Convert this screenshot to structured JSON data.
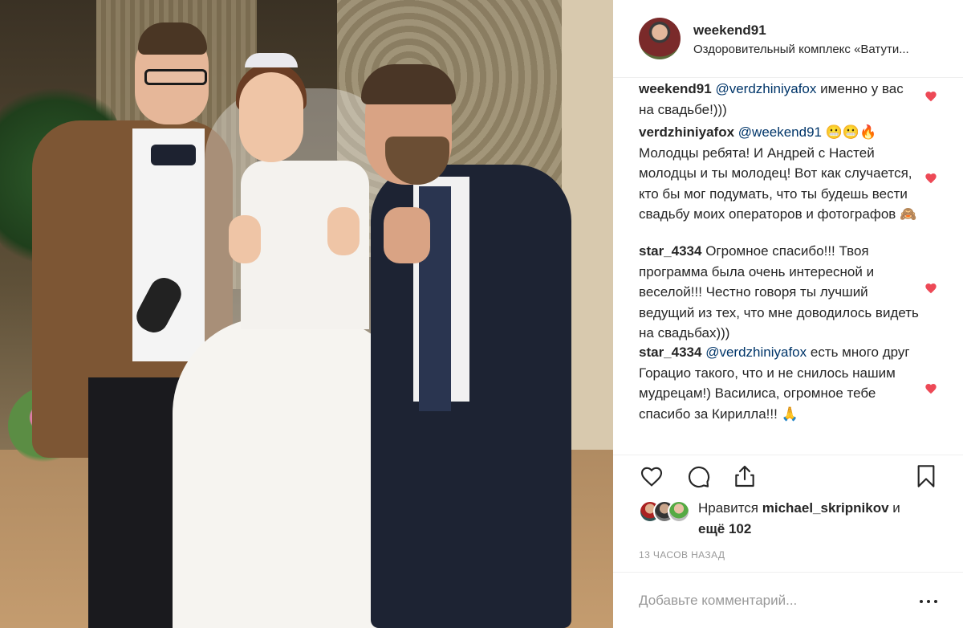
{
  "post": {
    "username": "weekend91",
    "location": "Оздоровительный комплекс «Ватути..."
  },
  "comments": [
    {
      "username": "weekend91",
      "mention": "@verdzhiniyafox",
      "text": " именно у вас на свадьбе!)))"
    },
    {
      "username": "verdzhiniyafox",
      "mention": "@weekend91",
      "text": " 😬😬🔥 Молодцы ребята! И Андрей с Настей молодцы и ты молодец! Вот как случается, кто бы мог подумать, что ты будешь вести свадьбу моих операторов и фотографов 🙈"
    },
    {
      "username": "star_4334",
      "mention": "",
      "text": "Огромное спасибо!!! Твоя программа была очень интересной и веселой!!! Честно говоря ты лучший ведущий из тех, что мне доводилось видеть на свадьбах)))"
    },
    {
      "username": "star_4334",
      "mention": "@verdzhiniyafox",
      "text": " есть много друг Горацио такого, что и не снилось нашим мудрецам!) Василиса, огромное тебе спасибо за Кирилла!!! 🙏"
    }
  ],
  "likes": {
    "prefix": "Нравится ",
    "user": "michael_skripnikov",
    "middle": " и ",
    "others": "ещё 102"
  },
  "time": "13 ЧАСОВ НАЗАД",
  "add_comment": {
    "placeholder": "Добавьте комментарий..."
  },
  "colors": {
    "heart": "#ed4956",
    "mention": "#003569",
    "muted": "#999999",
    "text": "#262626"
  },
  "icons": {
    "like": "heart-outline-icon",
    "comment": "comment-bubble-icon",
    "share": "share-icon",
    "save": "bookmark-icon",
    "more": "ellipsis-icon"
  }
}
